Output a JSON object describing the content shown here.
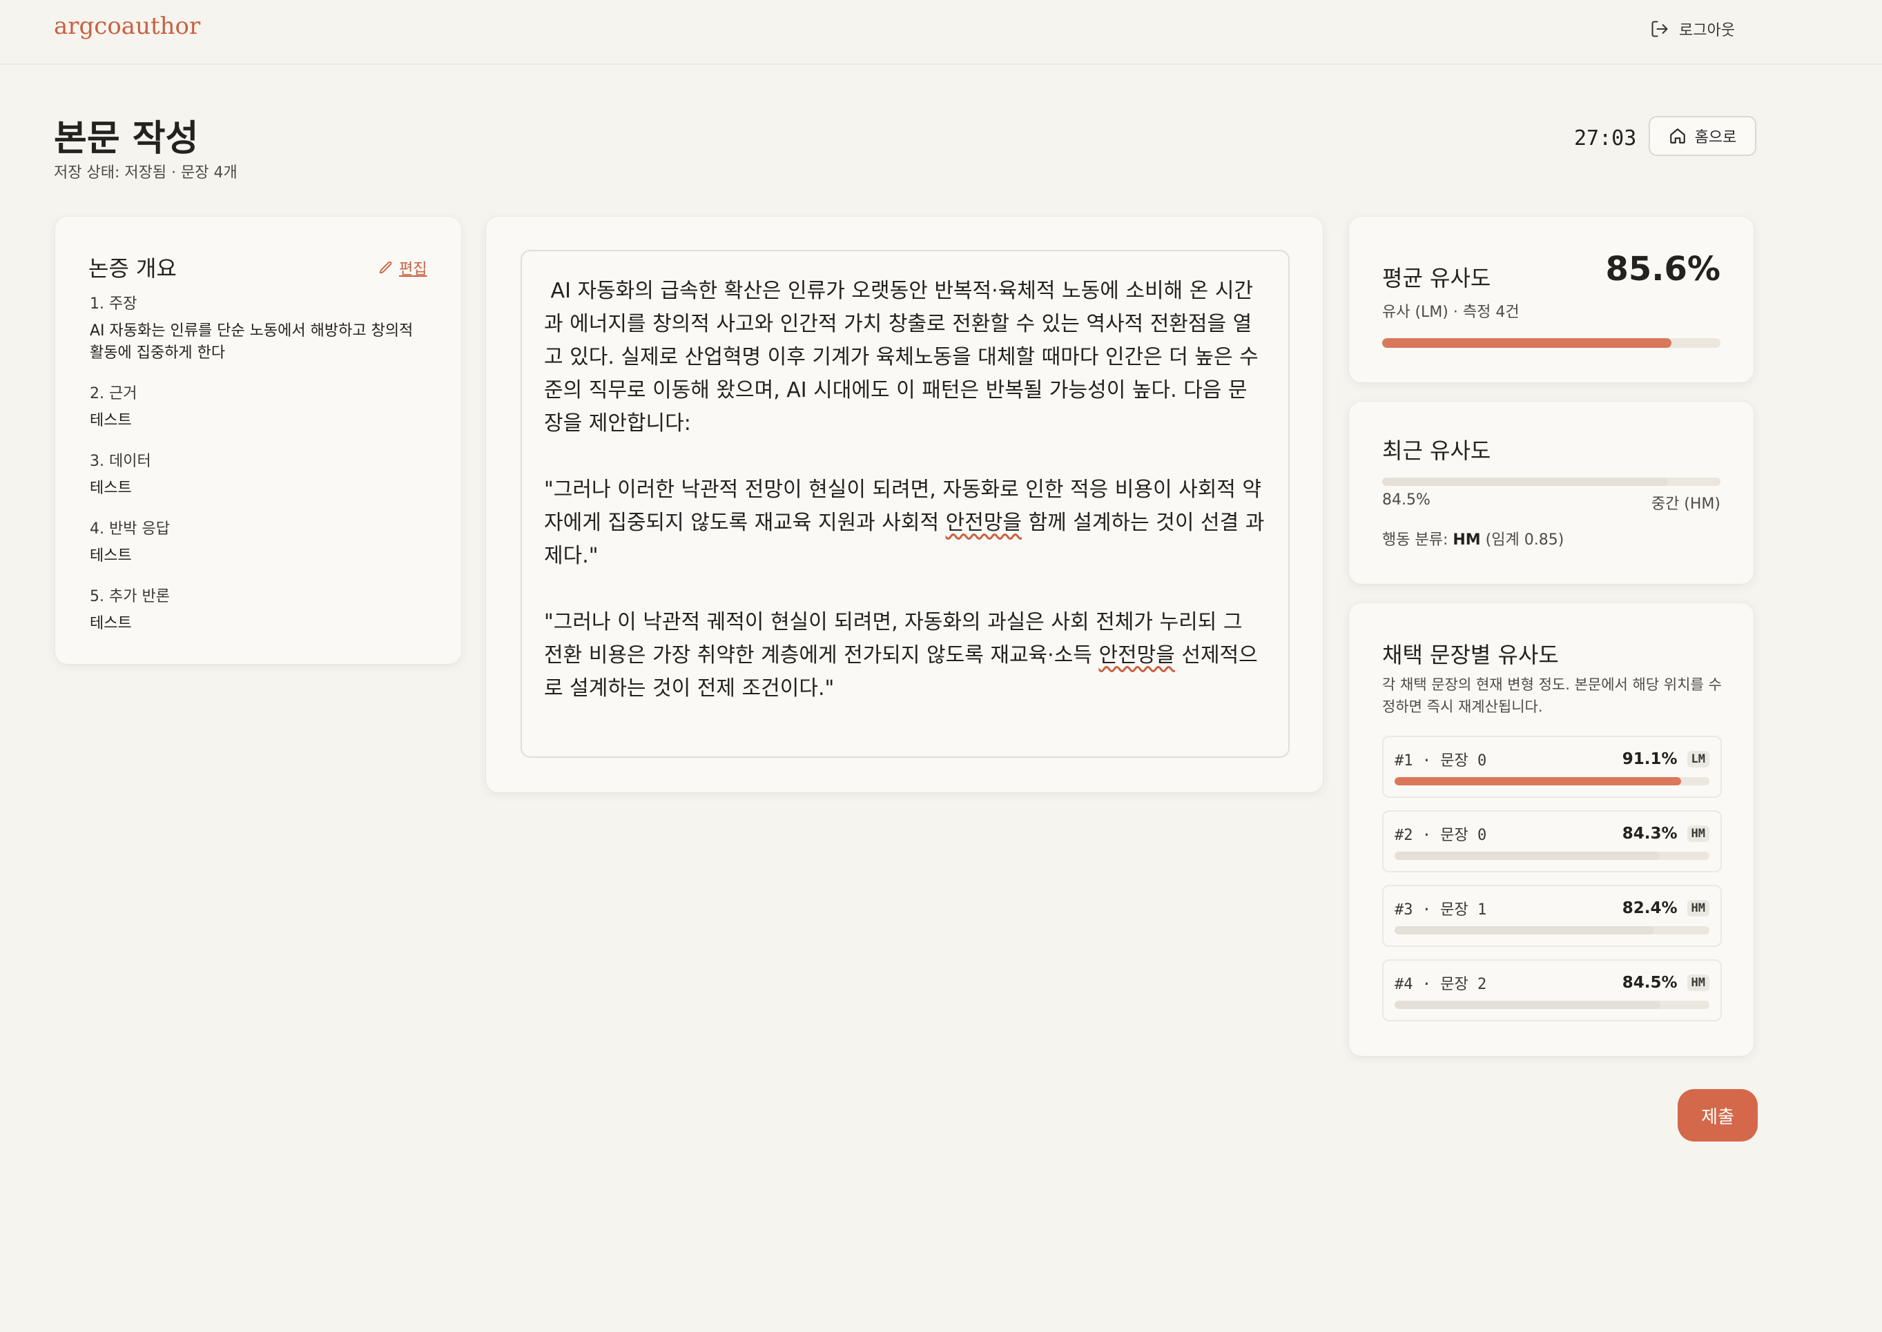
{
  "app": {
    "brand": "argcoauthor",
    "logout_label": "로그아웃"
  },
  "header": {
    "title": "본문 작성",
    "save_status": "저장 상태: 저장됨 · 문장 4개",
    "timer": "27:03",
    "home_label": "홈으로"
  },
  "outline": {
    "title": "논증 개요",
    "edit_label": "편집",
    "items": [
      {
        "label": "1. 주장",
        "value": "AI 자동화는 인류를 단순 노동에서 해방하고 창의적\n활동에 집중하게 한다"
      },
      {
        "label": "2. 근거",
        "value": "테스트"
      },
      {
        "label": "3. 데이터",
        "value": "테스트"
      },
      {
        "label": "4. 반박 응답",
        "value": "테스트"
      },
      {
        "label": "5. 추가 반론",
        "value": "테스트"
      }
    ]
  },
  "editor": {
    "paragraphs": [
      " AI 자동화의 급속한 확산은 인류가 오랫동안 반복적·육체적 노동에 소비해 온 시간과 에너지를 창의적 사고와 인간적 가치 창출로 전환할 수 있는 역사적 전환점을 열고 있다. 실제로 산업혁명 이후 기계가 육체노동을 대체할 때마다 인간은 더 높은 수준의 직무로 이동해 왔으며, AI 시대에도 이 패턴은 반복될 가능성이 높다. 다음 문장을 제안합니다:",
      "\"그러나 이러한 낙관적 전망이 현실이 되려면, 자동화로 인한 적응 비용이 사회적 약자에게 집중되지 않도록 재교육 지원과 사회적 ",
      "안전망을",
      " 함께 설계하는 것이 선결 과제다.\"",
      "\"그러나 이 낙관적 궤적이 현실이 되려면, 자동화의 과실은 사회 전체가 누리되 그 전환 비용은 가장 취약한 계층에게 전가되지 않도록 재교육·소득 ",
      "안전망을",
      " 선제적으로 설계하는 것이 전제 조건이다.\""
    ]
  },
  "avg_similarity": {
    "title": "평균 유사도",
    "value": "85.6%",
    "progress": 0.856,
    "subtitle": "유사 (LM) · 측정 4건",
    "color": "#d9785a"
  },
  "recent_similarity": {
    "title": "최근 유사도",
    "value": "84.5%",
    "progress": 0.845,
    "level": "중간 (HM)",
    "behavior_prefix": "행동 분류: ",
    "behavior_code": "HM",
    "behavior_suffix": " (임계 0.85)"
  },
  "adopted": {
    "title": "채택 문장별 유사도",
    "description": "각 채택 문장의 현재 변형 정도. 본문에서 해당 위치를 수정하면 즉시 재계산됩니다.",
    "items": [
      {
        "id": "#1 · 문장 0",
        "pct": "91.1%",
        "progress": 0.911,
        "badge": "LM",
        "highlight": true
      },
      {
        "id": "#2 · 문장 0",
        "pct": "84.3%",
        "progress": 0.843,
        "badge": "HM",
        "highlight": false
      },
      {
        "id": "#3 · 문장 1",
        "pct": "82.4%",
        "progress": 0.824,
        "badge": "HM",
        "highlight": false
      },
      {
        "id": "#4 · 문장 2",
        "pct": "84.5%",
        "progress": 0.845,
        "badge": "HM",
        "highlight": false
      }
    ]
  },
  "submit_label": "제출",
  "colors": {
    "accent": "#c9613f",
    "bar_fill": "#d9785a",
    "bar_track": "#ebe7df",
    "bar_grey": "#e4e0d8"
  }
}
